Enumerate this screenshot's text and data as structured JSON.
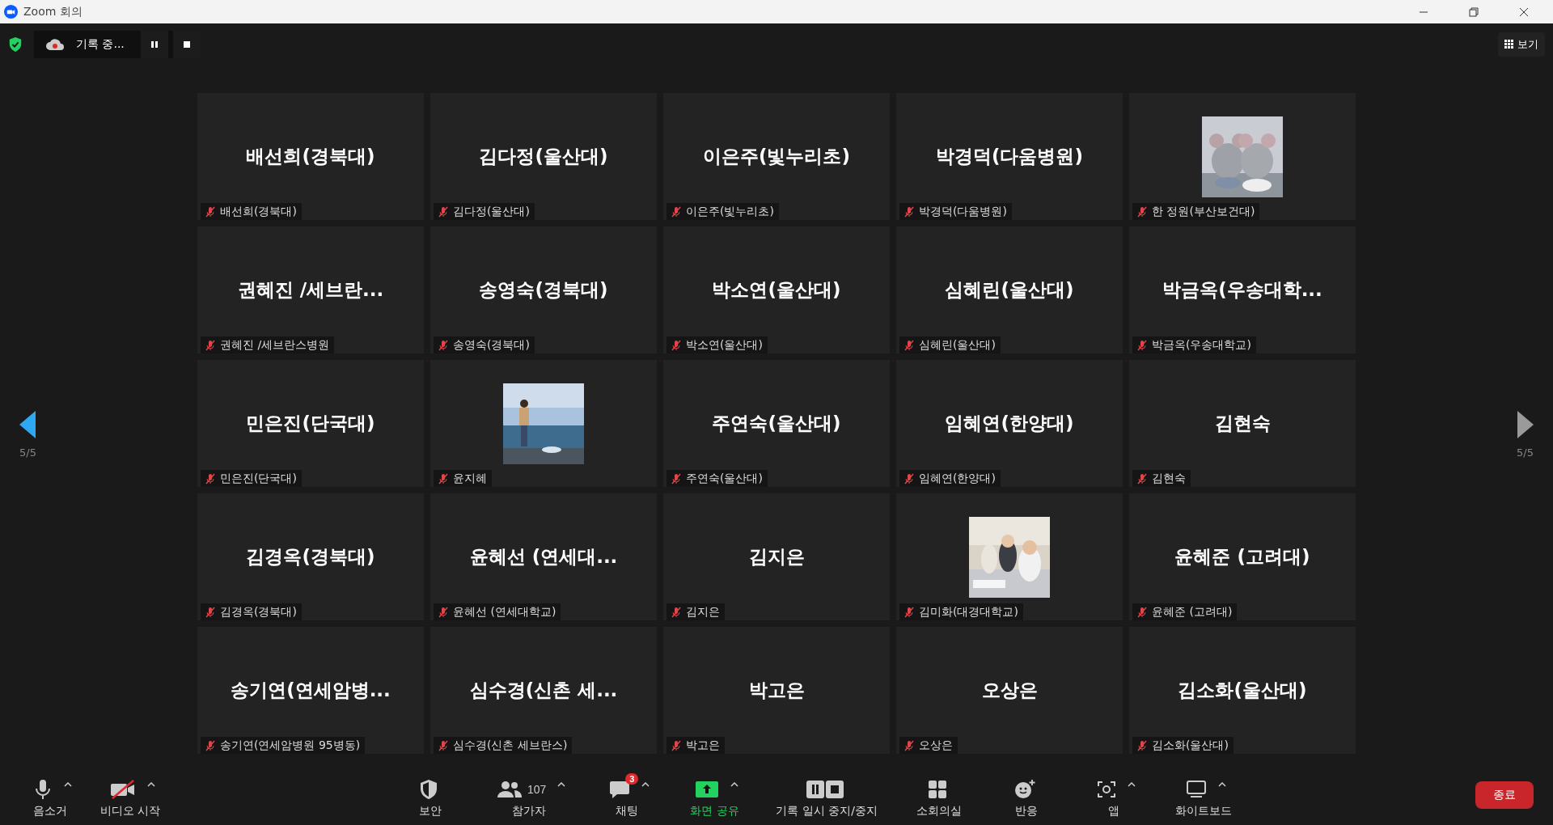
{
  "window": {
    "title": "Zoom 회의"
  },
  "top_bar": {
    "recording": {
      "label": "기록 중..."
    },
    "view_button": "보기"
  },
  "pager": [
    {
      "label": "5/5",
      "enabled": true
    },
    {
      "label": "5/5",
      "enabled": false
    }
  ],
  "tiles": [
    {
      "kind": "name",
      "display": "배선희(경북대)",
      "label": "배선희(경북대)",
      "muted": true
    },
    {
      "kind": "name",
      "display": "김다정(울산대)",
      "label": "김다정(울산대)",
      "muted": true
    },
    {
      "kind": "name",
      "display": "이은주(빛누리초)",
      "label": "이은주(빛누리초)",
      "muted": true
    },
    {
      "kind": "name",
      "display": "박경덕(다움병원)",
      "label": "박경덕(다움병원)",
      "muted": true
    },
    {
      "kind": "picture",
      "label": "한 정원(부산보건대)",
      "muted": true
    },
    {
      "kind": "name",
      "display": "권혜진 /세브란...",
      "label": "권혜진 /세브란스병원",
      "muted": true
    },
    {
      "kind": "name",
      "display": "송영숙(경북대)",
      "label": "송영숙(경북대)",
      "muted": true
    },
    {
      "kind": "name",
      "display": "박소연(울산대)",
      "label": "박소연(울산대)",
      "muted": true
    },
    {
      "kind": "name",
      "display": "심혜린(울산대)",
      "label": "심혜린(울산대)",
      "muted": true
    },
    {
      "kind": "name",
      "display": "박금옥(우송대학...",
      "label": "박금옥(우송대학교)",
      "muted": true
    },
    {
      "kind": "name",
      "display": "민은진(단국대)",
      "label": "민은진(단국대)",
      "muted": true
    },
    {
      "kind": "picture",
      "label": "윤지혜",
      "muted": true
    },
    {
      "kind": "name",
      "display": "주연숙(울산대)",
      "label": "주연숙(울산대)",
      "muted": true
    },
    {
      "kind": "name",
      "display": "임혜연(한양대)",
      "label": "임혜연(한양대)",
      "muted": true
    },
    {
      "kind": "name",
      "display": "김현숙",
      "label": "김현숙",
      "muted": true
    },
    {
      "kind": "name",
      "display": "김경옥(경북대)",
      "label": "김경옥(경북대)",
      "muted": true
    },
    {
      "kind": "name",
      "display": "윤혜선 (연세대...",
      "label": "윤혜선 (연세대학교)",
      "muted": true
    },
    {
      "kind": "name",
      "display": "김지은",
      "label": "김지은",
      "muted": true
    },
    {
      "kind": "picture",
      "label": "김미화(대경대학교)",
      "muted": true
    },
    {
      "kind": "name",
      "display": "윤혜준 (고려대)",
      "label": "윤혜준 (고려대)",
      "muted": true
    },
    {
      "kind": "name",
      "display": "송기연(연세암병...",
      "label": "송기연(연세암병원 95병동)",
      "muted": true
    },
    {
      "kind": "name",
      "display": "심수경(신촌 세...",
      "label": "심수경(신촌 세브란스)",
      "muted": true
    },
    {
      "kind": "name",
      "display": "박고은",
      "label": "박고은",
      "muted": true
    },
    {
      "kind": "name",
      "display": "오상은",
      "label": "오상은",
      "muted": true
    },
    {
      "kind": "name",
      "display": "김소화(울산대)",
      "label": "김소화(울산대)",
      "muted": true
    }
  ],
  "toolbar": {
    "left": [
      {
        "kind": "mic",
        "label": "음소거",
        "caret": true,
        "highlighted": false
      },
      {
        "kind": "video",
        "label": "비디오 시작",
        "caret": true,
        "highlighted": false,
        "crossed": true
      }
    ],
    "center": [
      {
        "kind": "security",
        "label": "보안",
        "caret": false,
        "highlighted": false
      },
      {
        "kind": "participants",
        "label": "참가자",
        "count": "107",
        "caret": true,
        "highlighted": false
      },
      {
        "kind": "chat",
        "label": "채팅",
        "badge": "3",
        "caret": true,
        "highlighted": false
      },
      {
        "kind": "share",
        "label": "화면 공유",
        "caret": true,
        "highlighted": true
      },
      {
        "kind": "record",
        "label": "기록 일시 중지/중지",
        "caret": false,
        "highlighted": false
      },
      {
        "kind": "breakout",
        "label": "소회의실",
        "caret": false,
        "highlighted": false
      },
      {
        "kind": "reactions",
        "label": "반응",
        "caret": false,
        "highlighted": false
      },
      {
        "kind": "apps",
        "label": "앱",
        "caret": true,
        "highlighted": false
      },
      {
        "kind": "whiteboard",
        "label": "화이트보드",
        "caret": true,
        "highlighted": false
      }
    ],
    "end_button": "종료"
  }
}
